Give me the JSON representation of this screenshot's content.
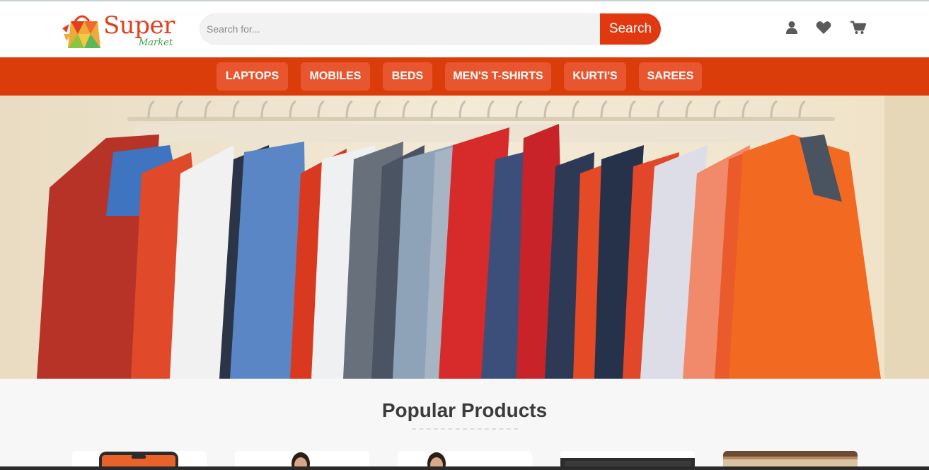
{
  "brand": {
    "name": "Super",
    "tagline": "Market"
  },
  "search": {
    "placeholder": "Search for...",
    "value": "",
    "button_label": "Search"
  },
  "header_icons": [
    "user-icon",
    "heart-icon",
    "cart-icon"
  ],
  "nav": {
    "items": [
      {
        "label": "LAPTOPS"
      },
      {
        "label": "MOBILES"
      },
      {
        "label": "BEDS"
      },
      {
        "label": "MEN'S T-SHIRTS"
      },
      {
        "label": "KURTI'S"
      },
      {
        "label": "SAREES"
      }
    ]
  },
  "hero": {
    "image": "clothing-rack-banner"
  },
  "popular": {
    "title": "Popular Products",
    "cards": [
      {
        "image": "smartphone"
      },
      {
        "image": "woman-in-kurti"
      },
      {
        "image": "woman-in-saree"
      },
      {
        "image": "laptop"
      },
      {
        "image": "bed"
      }
    ]
  },
  "colors": {
    "accent": "#e2380f",
    "nav": "#db3d0a",
    "nav_button": "#e7562e",
    "logo_green": "#3aa04a"
  }
}
